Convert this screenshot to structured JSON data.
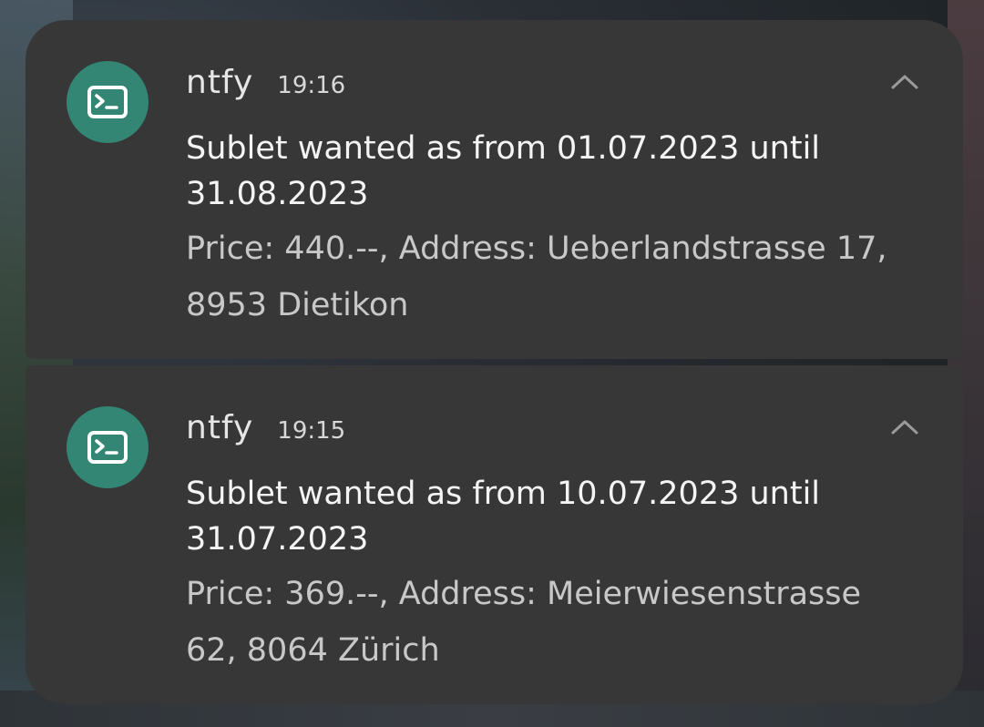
{
  "notifications": [
    {
      "app_name": "ntfy",
      "time": "19:16",
      "title": "Sublet wanted as from 01.07.2023 until 31.08.2023",
      "body": "Price: 440.--, Address: Ueberlandstrasse 17, 8953 Dietikon",
      "icon": "terminal-icon",
      "expand_icon": "chevron-up-icon"
    },
    {
      "app_name": "ntfy",
      "time": "19:15",
      "title": "Sublet wanted as from 10.07.2023 until 31.07.2023",
      "body": "Price: 369.--, Address: Meierwiesenstrasse 62, 8064 Zürich",
      "icon": "terminal-icon",
      "expand_icon": "chevron-up-icon"
    }
  ],
  "colors": {
    "card_background": "#373737",
    "app_icon_background": "#338574",
    "title_text": "#f4f4f4",
    "body_text": "#c8c8c8"
  }
}
